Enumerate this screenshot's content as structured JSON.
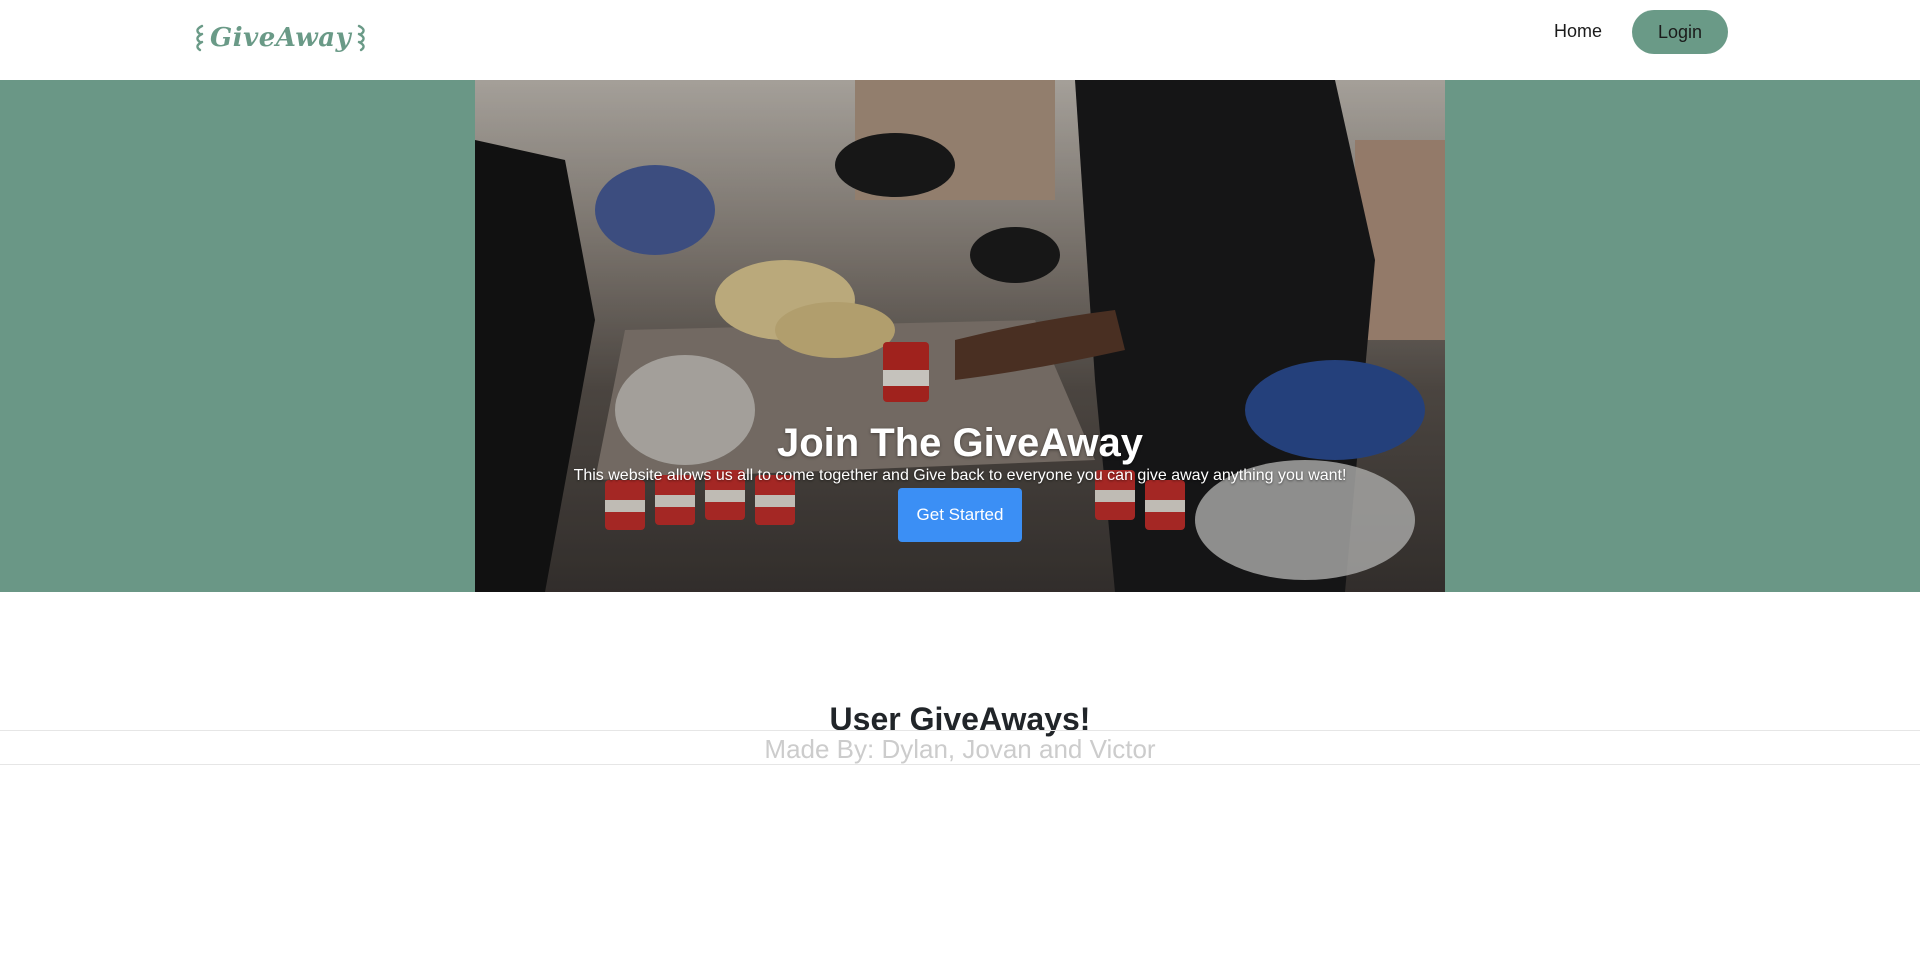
{
  "header": {
    "logo_text": "GiveAway",
    "nav_home": "Home",
    "nav_login": "Login"
  },
  "hero": {
    "title": "Join The GiveAway",
    "subtitle": "This website allows us all to come together and Give back to everyone you can give away anything you want!",
    "cta_label": "Get Started"
  },
  "main": {
    "section_title": "User GiveAways!"
  },
  "footer": {
    "credit": "Made By: Dylan, Jovan and Victor"
  },
  "colors": {
    "brand": "#6a9a87",
    "hero_background": "#6a9786",
    "cta": "#3b8ff5",
    "text": "#212529",
    "footer_text": "#cccccc"
  },
  "icons": {
    "logo": "sprig-logo-icon",
    "hero_image": "food-donation-photo"
  }
}
